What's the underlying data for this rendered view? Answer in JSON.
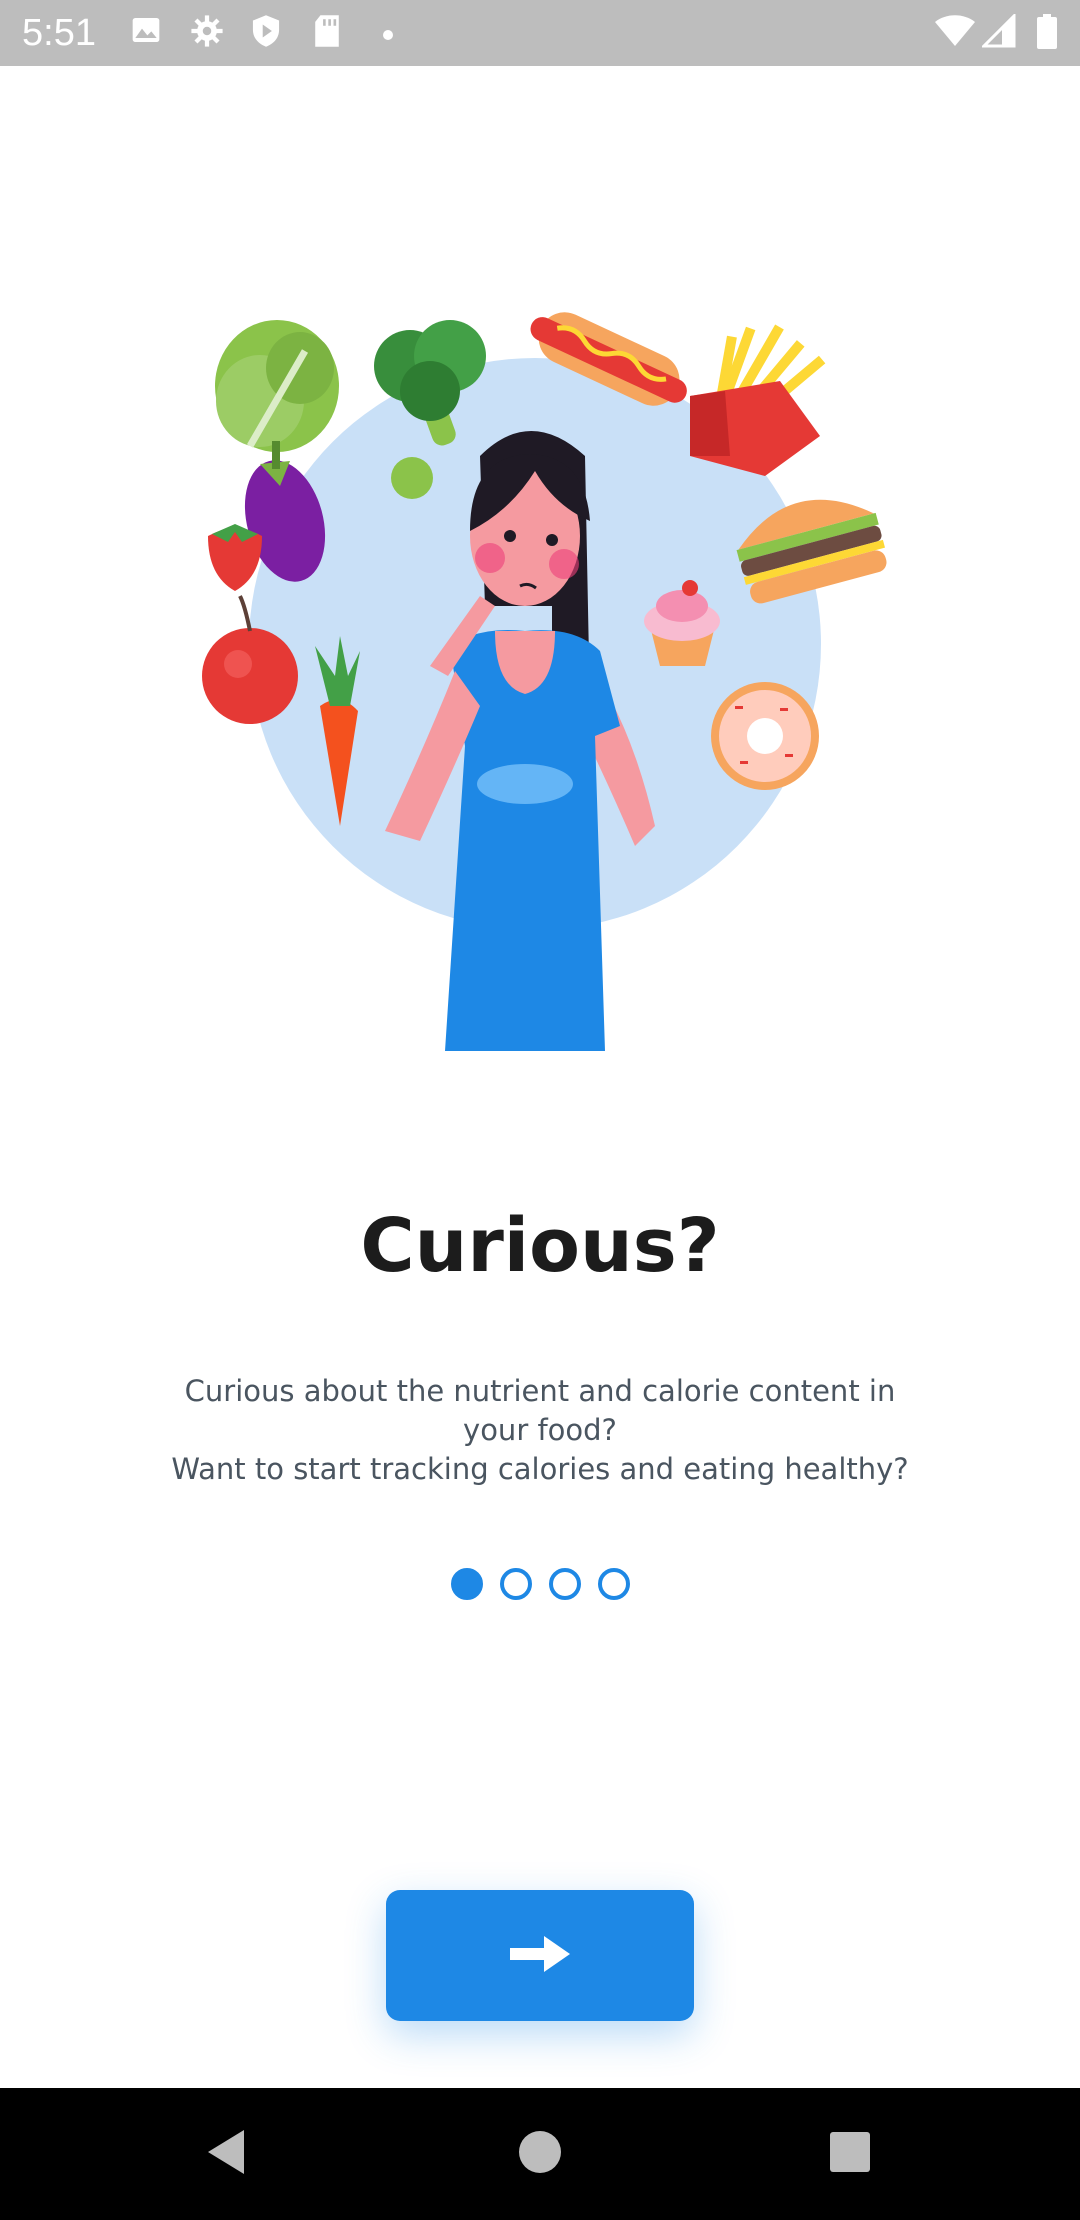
{
  "status_bar": {
    "time": "5:51",
    "left_icons": [
      "image-icon",
      "settings-gear-icon",
      "shield-play-icon",
      "sd-card-icon",
      "notification-dot-icon"
    ],
    "right_icons": [
      "wifi-icon",
      "cellular-signal-icon",
      "battery-icon"
    ]
  },
  "illustration": {
    "name": "woman-thinking-about-food-illustration",
    "colors": {
      "circle": "#c9e0f7",
      "dress": "#1e88e5",
      "skin": "#f59aa0",
      "hair": "#1f1a25"
    }
  },
  "onboarding": {
    "title": "Curious?",
    "description_lines": [
      "Curious about the nutrient and calorie content in",
      "your food?",
      "Want to start tracking calories and eating healthy?"
    ],
    "page_indicator": {
      "total": 4,
      "current": 1
    },
    "next_button_icon": "arrow-right-icon"
  },
  "nav_bar": {
    "buttons": [
      "back-triangle-icon",
      "home-circle-icon",
      "recents-square-icon"
    ]
  },
  "colors": {
    "accent": "#1e88e5",
    "title": "#1c1c1c",
    "body_text": "#4a5560",
    "status_bar": "#bdbdbd",
    "nav_bar": "#000000"
  }
}
